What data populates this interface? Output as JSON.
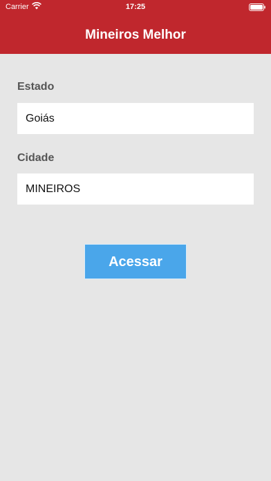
{
  "status_bar": {
    "carrier": "Carrier",
    "time": "17:25"
  },
  "header": {
    "title": "Mineiros Melhor"
  },
  "form": {
    "state_label": "Estado",
    "state_value": "Goiás",
    "city_label": "Cidade",
    "city_value": "MINEIROS",
    "submit_label": "Acessar"
  },
  "colors": {
    "header": "#c0272d",
    "background": "#e6e6e6",
    "button": "#4aa6ea"
  },
  "icons": [
    "wifi-icon",
    "battery-icon"
  ]
}
